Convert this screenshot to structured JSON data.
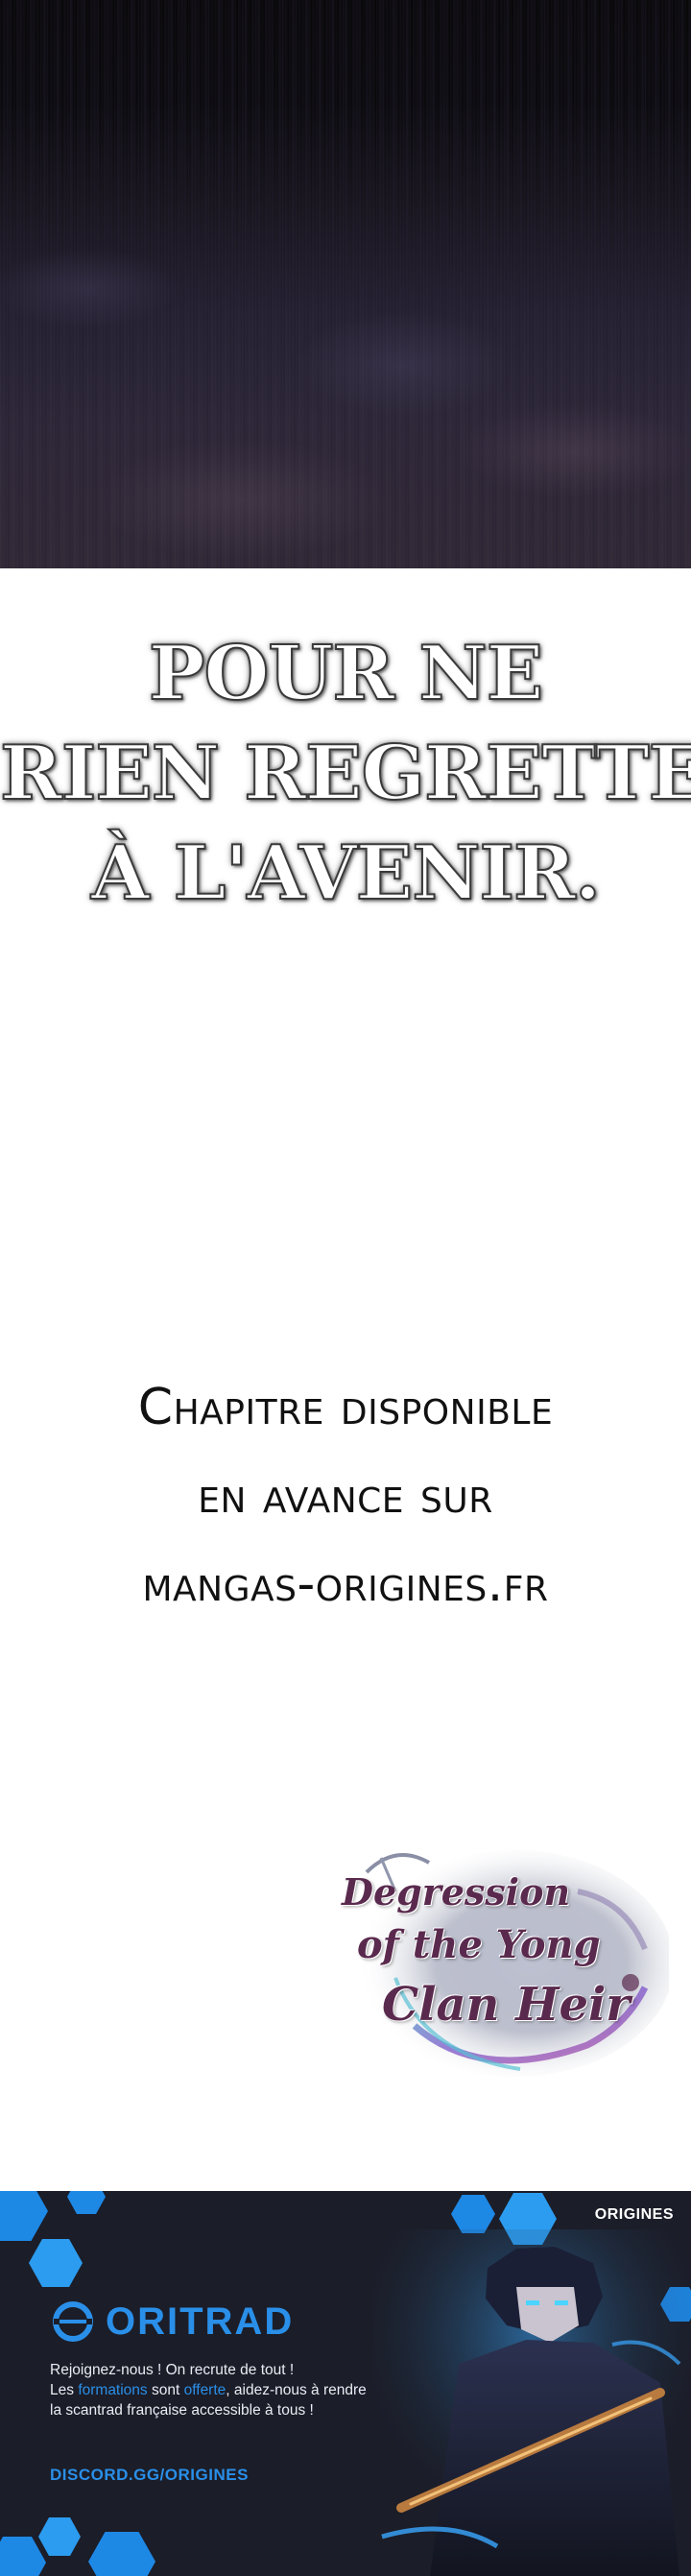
{
  "caption": {
    "lines": [
      "POUR NE",
      "RIEN REGRETTER",
      "À L'AVENIR."
    ]
  },
  "promo": {
    "lines": [
      "Chapitre disponible",
      "en avance sur",
      "mangas-origines.fr"
    ]
  },
  "series_logo": {
    "lines": [
      "Degression",
      "of the Yong",
      "Clan Heir"
    ]
  },
  "banner": {
    "origines_label": "ORIGINES",
    "oritrad_label": "ORITRAD",
    "copy_line1": "Rejoignez-nous ! On recrute de tout !",
    "copy_les": "Les ",
    "copy_formations": "formations",
    "copy_sont": " sont ",
    "copy_offerte": "offerte",
    "copy_rest": ", aidez-nous à rendre la scantrad française accessible à tous !",
    "discord": "DISCORD.GG/ORIGINES",
    "accent_color": "#2a8fe8",
    "hex_color": "#1e88e5",
    "background_color": "#1b1d28"
  }
}
